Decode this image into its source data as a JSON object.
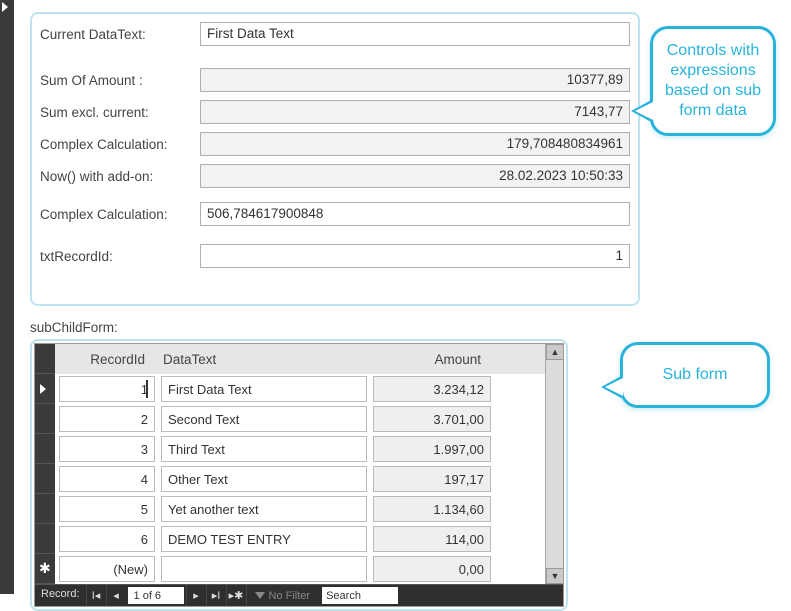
{
  "fields": {
    "currentDataText": {
      "label": "Current DataText:",
      "value": "First Data Text"
    },
    "sumOfAmount": {
      "label": "Sum Of Amount :",
      "value": "10377,89"
    },
    "sumExclCurrent": {
      "label": "Sum excl. current:",
      "value": "7143,77"
    },
    "complexCalc1": {
      "label": "Complex Calculation:",
      "value": "179,708480834961"
    },
    "nowAddon": {
      "label": "Now() with add-on:",
      "value": "28.02.2023 10:50:33"
    },
    "complexCalc2": {
      "label": "Complex Calculation:",
      "value": "506,784617900848"
    },
    "txtRecordId": {
      "label": "txtRecordId:",
      "value": "1"
    }
  },
  "callouts": {
    "top": "Controls with expressions based on sub form data",
    "subform": "Sub form"
  },
  "subform": {
    "label": "subChildForm:",
    "headers": {
      "recordId": "RecordId",
      "dataText": "DataText",
      "amount": "Amount"
    },
    "rows": [
      {
        "recordId": "1",
        "dataText": "First Data Text",
        "amount": "3.234,12"
      },
      {
        "recordId": "2",
        "dataText": "Second Text",
        "amount": "3.701,00"
      },
      {
        "recordId": "3",
        "dataText": "Third Text",
        "amount": "1.997,00"
      },
      {
        "recordId": "4",
        "dataText": "Other Text",
        "amount": "197,17"
      },
      {
        "recordId": "5",
        "dataText": "Yet another text",
        "amount": "1.134,60"
      },
      {
        "recordId": "6",
        "dataText": "DEMO TEST ENTRY",
        "amount": "114,00"
      }
    ],
    "newRow": {
      "recordId": "(New)",
      "dataText": "",
      "amount": "0,00"
    },
    "nav": {
      "label": "Record:",
      "counter": "1 of 6",
      "filter": "No Filter",
      "search": "Search"
    }
  }
}
